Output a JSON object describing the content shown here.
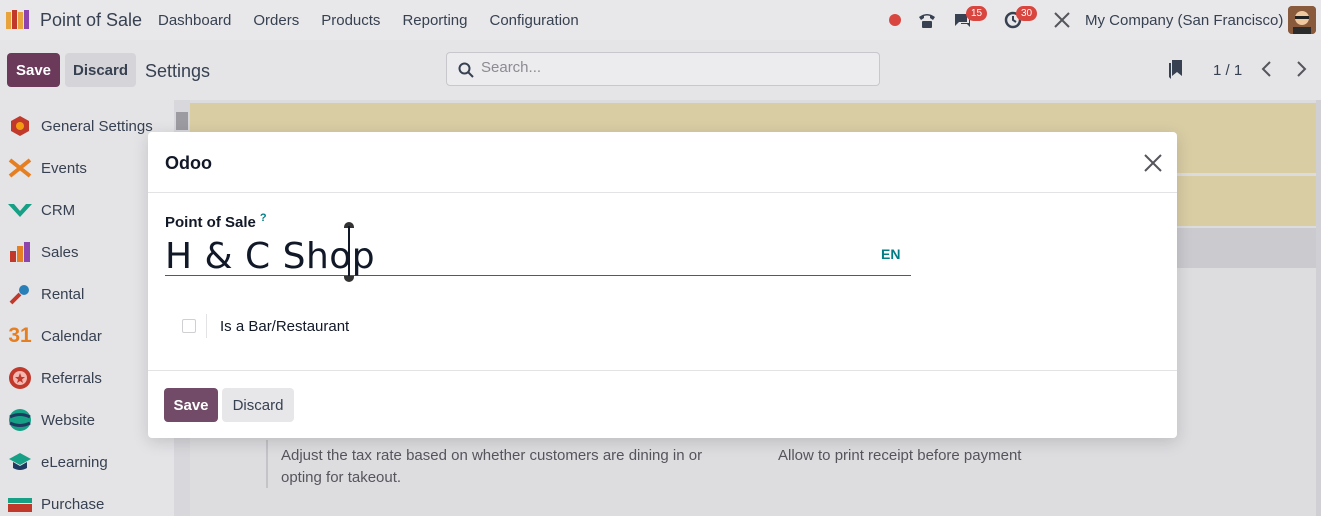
{
  "navbar": {
    "app_name": "Point of Sale",
    "menu": [
      "Dashboard",
      "Orders",
      "Products",
      "Reporting",
      "Configuration"
    ],
    "messages_count": "15",
    "activities_count": "30",
    "company": "My Company (San Francisco)"
  },
  "control": {
    "save_label": "Save",
    "discard_label": "Discard",
    "breadcrumb": "Settings",
    "search_placeholder": "Search...",
    "pager": "1 / 1"
  },
  "sidebar": {
    "items": [
      {
        "label": "General Settings",
        "icon": "settings-hexagon-icon"
      },
      {
        "label": "Events",
        "icon": "events-icon"
      },
      {
        "label": "CRM",
        "icon": "crm-icon"
      },
      {
        "label": "Sales",
        "icon": "sales-chart-icon"
      },
      {
        "label": "Rental",
        "icon": "rental-key-icon"
      },
      {
        "label": "Calendar",
        "icon": "calendar-icon"
      },
      {
        "label": "Referrals",
        "icon": "referrals-icon"
      },
      {
        "label": "Website",
        "icon": "website-globe-icon"
      },
      {
        "label": "eLearning",
        "icon": "elearning-cap-icon"
      },
      {
        "label": "Purchase",
        "icon": "purchase-icon"
      }
    ]
  },
  "background": {
    "text_left": "Adjust the tax rate based on whether customers are dining in or opting for takeout.",
    "text_right": "Allow to print receipt before payment"
  },
  "modal": {
    "title": "Odoo",
    "field_label": "Point of Sale",
    "help_mark": "?",
    "name_value": "H & C Shop",
    "lang": "EN",
    "checkbox_label": "Is a Bar/Restaurant",
    "checkbox_checked": false,
    "save_label": "Save",
    "discard_label": "Discard"
  },
  "colors": {
    "brand": "#714b67",
    "accent": "#017e84",
    "badge": "#d9453f"
  }
}
